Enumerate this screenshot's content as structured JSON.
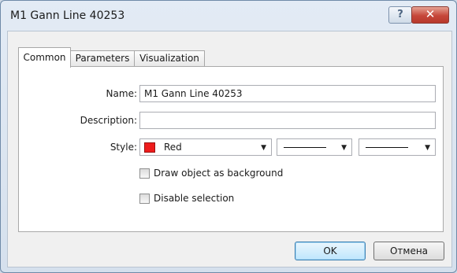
{
  "window": {
    "title": "M1 Gann Line 40253",
    "help_label": "?",
    "close_label": "✕"
  },
  "tabs": [
    {
      "label": "Common",
      "active": true
    },
    {
      "label": "Parameters",
      "active": false
    },
    {
      "label": "Visualization",
      "active": false
    }
  ],
  "form": {
    "name_label": "Name:",
    "name_value": "M1 Gann Line 40253",
    "description_label": "Description:",
    "description_value": "",
    "style_label": "Style:",
    "color_value": "Red",
    "color_hex": "#ee1c1c",
    "line_style_value": "solid",
    "line_width_value": "thin",
    "checkboxes": [
      {
        "label": "Draw object as background",
        "checked": false
      },
      {
        "label": "Disable selection",
        "checked": false
      }
    ]
  },
  "buttons": {
    "ok_label": "OK",
    "cancel_label": "Отмена"
  },
  "icons": {
    "dropdown": "chevron-down-icon",
    "help": "help-icon",
    "close": "close-icon"
  }
}
